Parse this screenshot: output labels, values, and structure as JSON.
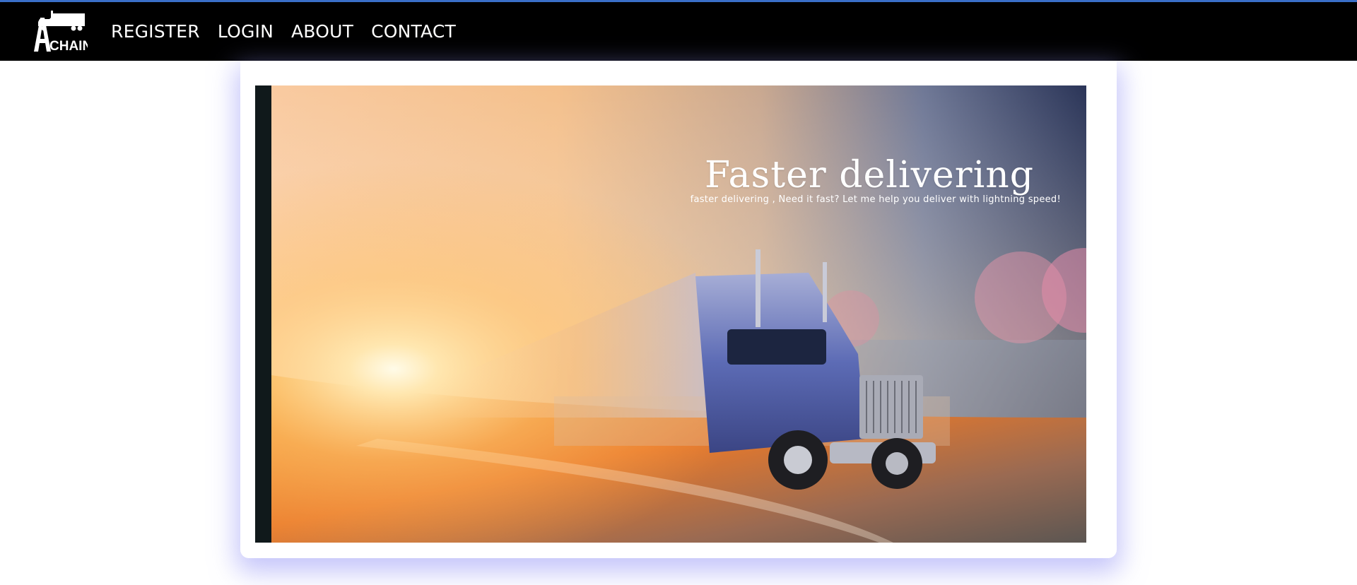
{
  "brand": {
    "logo_text": "CHAIN",
    "logo_initial": "A",
    "accent_color": "#3a6fc8"
  },
  "nav": {
    "items": [
      {
        "label": "REGISTER"
      },
      {
        "label": "LOGIN"
      },
      {
        "label": "ABOUT"
      },
      {
        "label": "CONTACT"
      }
    ]
  },
  "hero": {
    "title": "Faster delivering",
    "subtitle": "faster delivering , Need it fast? Let me help you deliver with lightning speed!",
    "image_subject": "semi-truck-on-highway-at-sunset"
  }
}
